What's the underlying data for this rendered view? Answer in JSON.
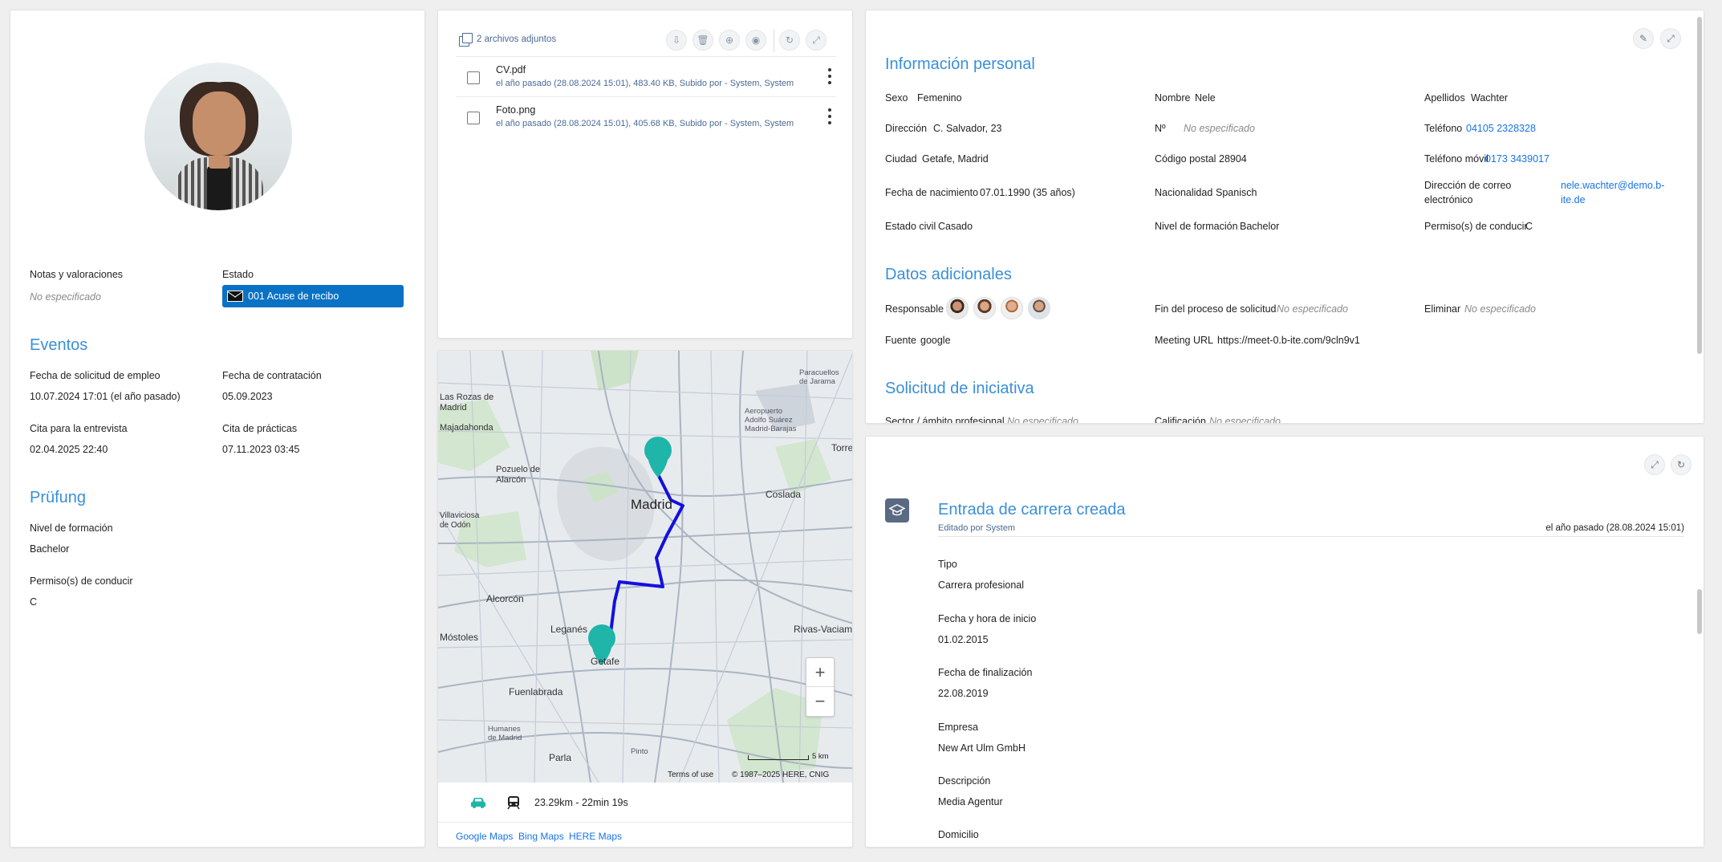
{
  "profile": {
    "notas_label": "Notas y valoraciones",
    "notas_value": "No especificado",
    "estado_label": "Estado",
    "estado_value": "001 Acuse de recibo",
    "eventos_title": "Eventos",
    "eventos": [
      {
        "label": "Fecha de solicitud de empleo",
        "value": "10.07.2024 17:01 (el año pasado)"
      },
      {
        "label": "Fecha de contratación",
        "value": "05.09.2023"
      },
      {
        "label": "Cita para la entrevista",
        "value": "02.04.2025 22:40"
      },
      {
        "label": "Cita de prácticas",
        "value": "07.11.2023 03:45"
      }
    ],
    "prufung_title": "Prüfung",
    "prufung": [
      {
        "label": "Nivel de formación",
        "value": "Bachelor"
      },
      {
        "label": "Permiso(s) de conducir",
        "value": "C"
      }
    ]
  },
  "attachments": {
    "header": "2 archivos adjuntos",
    "toolbar_icons": [
      "download-icon",
      "trash-icon",
      "add-icon",
      "eye-icon",
      "refresh-icon",
      "expand-icon"
    ],
    "files": [
      {
        "name": "CV.pdf",
        "meta": "el año pasado (28.08.2024 15:01), 483.40 KB, Subido por - System, System"
      },
      {
        "name": "Foto.png",
        "meta": "el año pasado (28.08.2024 15:01), 405.68 KB, Subido por - System, System"
      }
    ]
  },
  "map": {
    "labels": {
      "madrid": "Madrid",
      "getafe": "Getafe",
      "leganes": "Leganés",
      "alcorcon": "Alcorcón",
      "mostoles": "Móstoles",
      "fuenlabrada": "Fuenlabrada",
      "parla": "Parla",
      "coslada": "Coslada",
      "pozuelo": "Pozuelo de Alarcón",
      "rivas": "Rivas-Vaciama",
      "rozas": "Las Rozas de Madrid",
      "majadahonda": "Majadahonda",
      "villaviciosa": "Villaviciosa de Odón",
      "humanes": "Humanes de Madrid",
      "pinto": "Pinto",
      "aeropuerto": "Aeropuerto Adolfo Suárez Madrid-Barajas",
      "paracuellos": "Paracuellos de Jarama",
      "torrejon": "Torre"
    },
    "scale": "5 km",
    "terms": "Terms of use",
    "copyright": "© 1987–2025 HERE, CNIG",
    "route_info": "23.29km - 22min 19s",
    "links": [
      "Google Maps",
      "Bing Maps",
      "HERE Maps"
    ],
    "route_color": "#1410e0",
    "marker_color": "#1fb5a8"
  },
  "info": {
    "personal_title": "Información personal",
    "personal": [
      {
        "label": "Sexo",
        "value": "Femenino"
      },
      {
        "label": "Nombre",
        "value": "Nele"
      },
      {
        "label": "Apellidos",
        "value": "Wachter"
      },
      {
        "label": "Dirección",
        "value": "C. Salvador, 23"
      },
      {
        "label": "Nº",
        "value": "No especificado"
      },
      {
        "label": "Teléfono",
        "value": "04105 2328328"
      },
      {
        "label": "Ciudad",
        "value": "Getafe, Madrid"
      },
      {
        "label": "Código postal",
        "value": "28904"
      },
      {
        "label": "Teléfono móvil",
        "value": "0173 3439017"
      },
      {
        "label": "Fecha de nacimiento",
        "value": "07.01.1990 (35 años)"
      },
      {
        "label": "Nacionalidad",
        "value": "Spanisch"
      },
      {
        "label": "Dirección de correo electrónico",
        "value": "nele.wachter@demo.b-ite.de"
      },
      {
        "label": "Estado civil",
        "value": "Casado"
      },
      {
        "label": "Nivel de formación",
        "value": "Bachelor"
      },
      {
        "label": "Permiso(s) de conducir",
        "value": "C"
      }
    ],
    "email_label_1": "Dirección de correo",
    "email_label_2": "electrónico",
    "email_value_1": "nele.wachter@demo.b-",
    "email_value_2": "ite.de",
    "adicionales_title": "Datos adicionales",
    "adicionales": [
      {
        "label": "Responsable",
        "value": ""
      },
      {
        "label": "Fin del proceso de solicitud",
        "value": "No especificado"
      },
      {
        "label": "Eliminar",
        "value": "No especificado"
      },
      {
        "label": "Fuente",
        "value": "google"
      },
      {
        "label": "Meeting URL",
        "value": "https://meet-0.b-ite.com/9cln9v1"
      }
    ],
    "iniciativa_title": "Solicitud de iniciativa",
    "iniciativa": [
      {
        "label": "Sector / ámbito profesional",
        "value": "No especificado"
      },
      {
        "label": "Calificación",
        "value": "No especificado"
      }
    ]
  },
  "timeline": {
    "title": "Entrada de carrera creada",
    "edited_by": "Editado por System",
    "timestamp": "el año pasado (28.08.2024 15:01)",
    "fields": [
      {
        "label": "Tipo",
        "value": "Carrera profesional"
      },
      {
        "label": "Fecha y hora de inicio",
        "value": "01.02.2015"
      },
      {
        "label": "Fecha de finalización",
        "value": "22.08.2019"
      },
      {
        "label": "Empresa",
        "value": "New Art Ulm GmbH"
      },
      {
        "label": "Descripción",
        "value": "Media Agentur"
      },
      {
        "label": "Domicilio",
        "value": ""
      }
    ]
  }
}
